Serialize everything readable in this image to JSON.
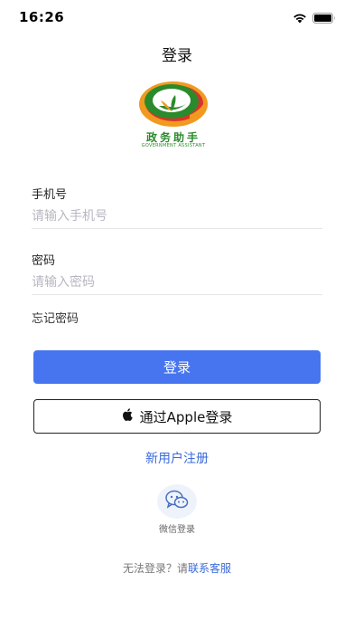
{
  "status_bar": {
    "time": "16:26",
    "icons": [
      "wifi-icon",
      "battery-icon"
    ]
  },
  "header": {
    "title": "登录"
  },
  "logo": {
    "name_cn": "政务助手",
    "name_en": "GOVERNMENT ASSISTANT",
    "colors": {
      "green": "#2b8a2b",
      "orange": "#f29a1f",
      "red": "#d8332b"
    }
  },
  "form": {
    "phone": {
      "label": "手机号",
      "value": "",
      "placeholder": "请输入手机号"
    },
    "password": {
      "label": "密码",
      "value": "",
      "placeholder": "请输入密码"
    },
    "forgot_label": "忘记密码"
  },
  "buttons": {
    "login_label": "登录",
    "apple_label": "通过Apple登录",
    "apple_icon": "apple-icon",
    "register_label": "新用户注册"
  },
  "wechat": {
    "icon": "wechat-icon",
    "label": "微信登录"
  },
  "help": {
    "prefix": "无法登录？请",
    "link": "联系客服"
  },
  "colors": {
    "accent": "#4775f0",
    "link": "#3a6bd8",
    "placeholder": "#b7b7c2"
  }
}
